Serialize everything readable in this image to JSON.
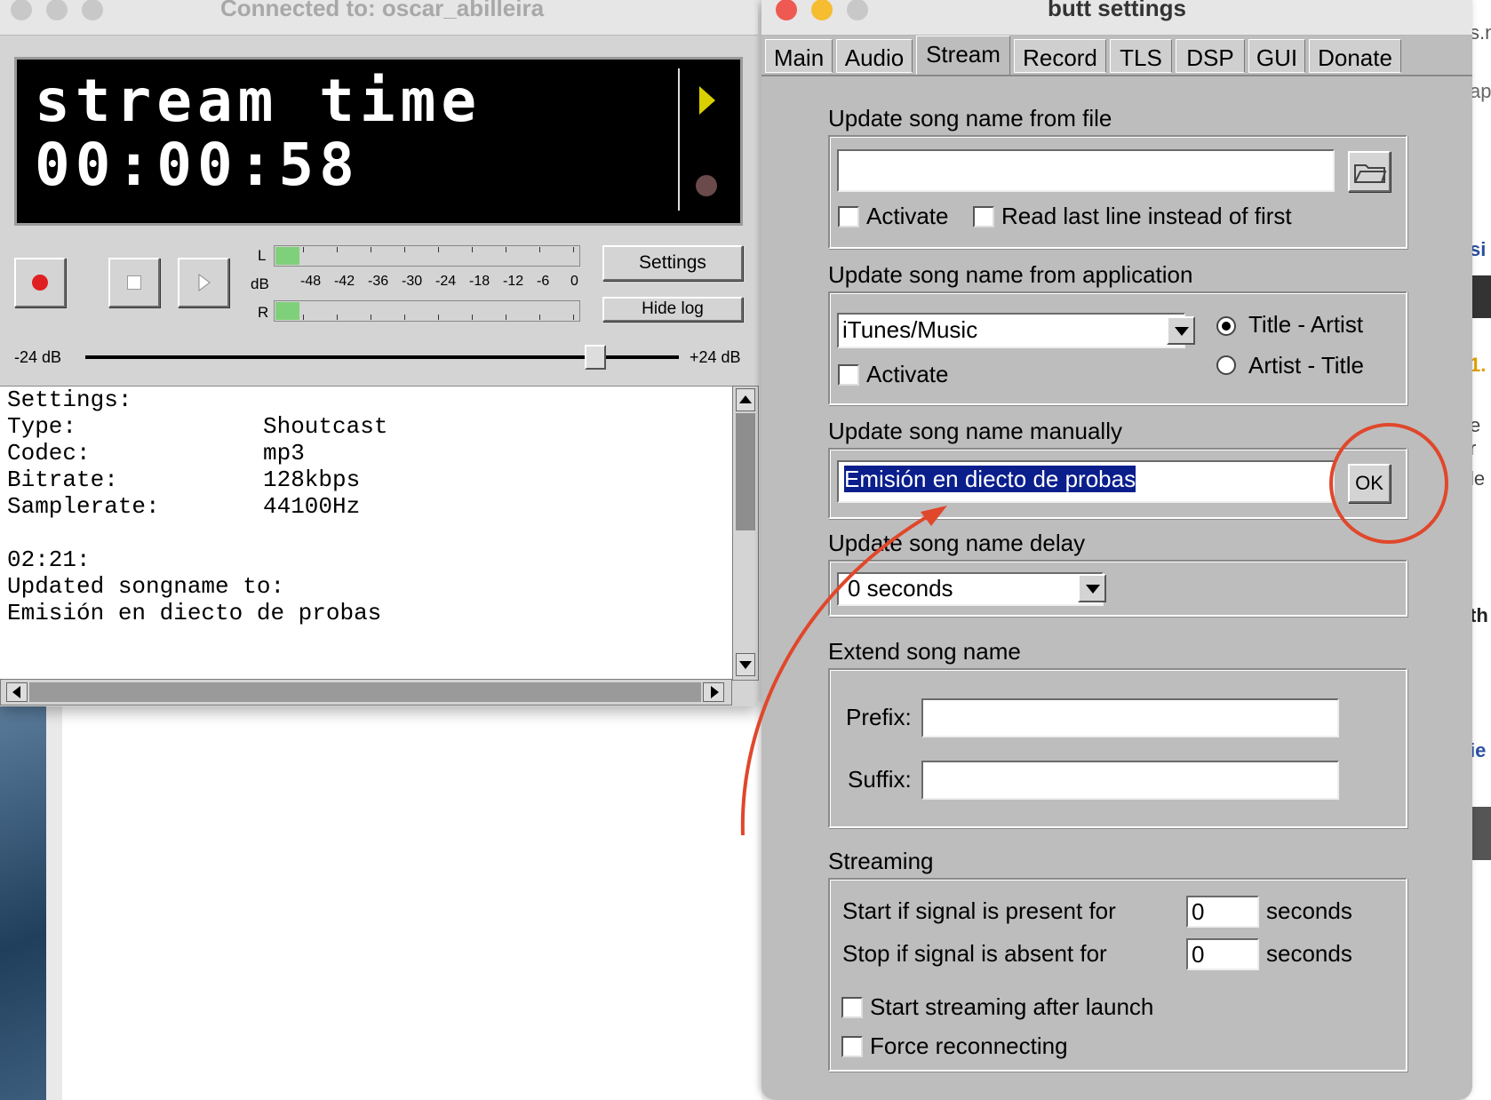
{
  "main_window": {
    "title": "Connected to: oscar_abilleira",
    "lcd": {
      "line1": "stream time",
      "line2": "00:00:58"
    },
    "vu": {
      "left_label": "L",
      "db_label": "dB",
      "right_label": "R",
      "scale": [
        "-48",
        "-42",
        "-36",
        "-30",
        "-24",
        "-18",
        "-12",
        "-6",
        "0"
      ],
      "left_level": 0.08,
      "right_level": 0.08
    },
    "buttons": {
      "settings": "Settings",
      "hide_log": "Hide log"
    },
    "gain": {
      "min_label": "-24 dB",
      "max_label": "+24 dB",
      "value_fraction": 0.86
    },
    "log": {
      "header": "Settings:",
      "rows": [
        {
          "key": "Type:",
          "value": "Shoutcast"
        },
        {
          "key": "Codec:",
          "value": "mp3"
        },
        {
          "key": "Bitrate:",
          "value": "128kbps"
        },
        {
          "key": "Samplerate:",
          "value": "44100Hz"
        }
      ],
      "time": "02:21:",
      "msg1": "Updated songname to:",
      "msg2": "Emisión en diecto de probas"
    }
  },
  "settings_window": {
    "title": "butt settings",
    "tabs": [
      "Main",
      "Audio",
      "Stream",
      "Record",
      "TLS",
      "DSP",
      "GUI",
      "Donate"
    ],
    "active_tab": "Stream",
    "from_file": {
      "label": "Update song name from file",
      "path": "",
      "activate": "Activate",
      "read_last": "Read last line instead of first"
    },
    "from_app": {
      "label": "Update song name from application",
      "app": "iTunes/Music",
      "activate": "Activate",
      "opt1": "Title - Artist",
      "opt2": "Artist - Title"
    },
    "manual": {
      "label": "Update song name manually",
      "value": "Emisión en diecto de probas",
      "ok": "OK"
    },
    "delay": {
      "label": "Update song name delay",
      "value": "0 seconds"
    },
    "extend": {
      "label": "Extend song name",
      "prefix_label": "Prefix:",
      "suffix_label": "Suffix:",
      "prefix": "",
      "suffix": ""
    },
    "streaming": {
      "label": "Streaming",
      "start_label": "Start if signal is present for",
      "start_value": "0",
      "stop_label": "Stop if signal is absent for",
      "stop_value": "0",
      "unit": "seconds",
      "after_launch": "Start streaming after launch",
      "force": "Force reconnecting"
    }
  },
  "right_strip": {
    "t1": "s.n",
    "t2": "ap",
    "t3": "si",
    "t4": "1.",
    "t5": "e r",
    "t6": "le",
    "t7": "th",
    "t8": "ie"
  },
  "colors": {
    "annotation": "#e0472b",
    "selection": "#0a1e8c",
    "record_red": "#e02020",
    "play_yellow": "#d8d000"
  }
}
